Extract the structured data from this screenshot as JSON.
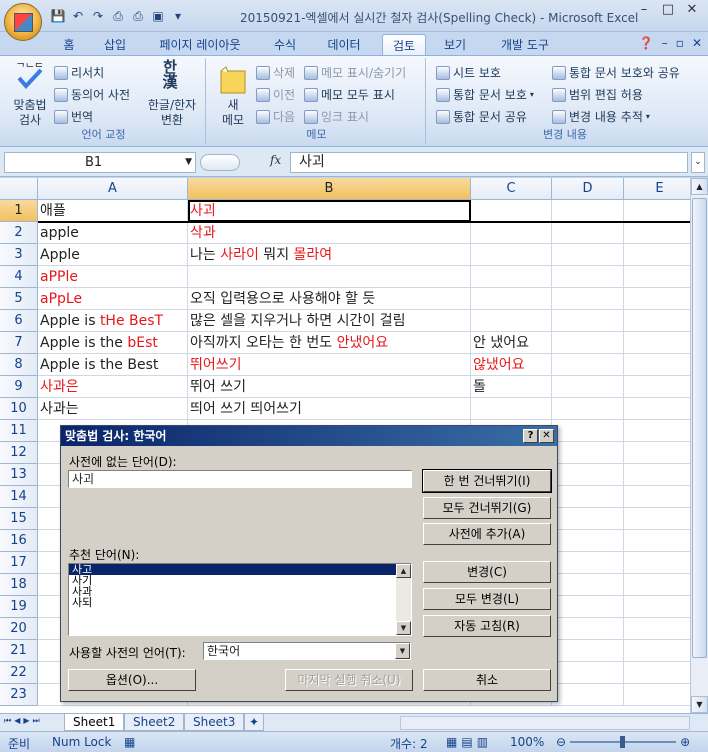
{
  "window": {
    "title": "20150921-엑셀에서 실시간 철자 검사(Spelling Check) - Microsoft Excel",
    "minimize": "–",
    "restore": "□",
    "close": "✕"
  },
  "qat": {
    "save": "▪",
    "undo": "↶",
    "redo": "↷",
    "print_preview": "⎙",
    "quick_print": "⎙",
    "spelling": "▣",
    "more": "▾"
  },
  "tabs": [
    "홈",
    "삽입",
    "페이지 레이아웃",
    "수식",
    "데이터",
    "검토",
    "보기",
    "개발 도구"
  ],
  "active_tab": "검토",
  "ribbon": {
    "proofing": {
      "label": "언어 교정",
      "spelling": "맞춤법\n검사",
      "research": "리서치",
      "thesaurus": "동의어 사전",
      "translate": "번역",
      "hanja": "한글/한자\n변환",
      "hanja_icon": "한\n漢"
    },
    "comments": {
      "label": "메모",
      "new": "새\n메모",
      "delete": "삭제",
      "previous": "이전",
      "next": "다음",
      "show_hide": "메모 표시/숨기기",
      "show_all": "메모 모두 표시",
      "show_ink": "잉크 표시"
    },
    "changes": {
      "label": "변경 내용",
      "protect_sheet": "시트 보호",
      "protect_workbook": "통합 문서 보호",
      "share_workbook": "통합 문서 공유",
      "protect_share": "통합 문서 보호와 공유",
      "allow_edit_ranges": "범위 편집 허용",
      "track_changes": "변경 내용 추적"
    }
  },
  "formula_bar": {
    "name_box": "B1",
    "fx": "fx",
    "value": "사괴"
  },
  "columns": [
    "A",
    "B",
    "C",
    "D",
    "E"
  ],
  "rows": [
    "1",
    "2",
    "3",
    "4",
    "5",
    "6",
    "7",
    "8",
    "9",
    "10",
    "11",
    "12",
    "13",
    "14",
    "15",
    "16",
    "17",
    "18",
    "19",
    "20",
    "21",
    "22",
    "23"
  ],
  "cells": {
    "A1": "애플",
    "B1": "사괴",
    "A2": "apple",
    "B2": "삭과",
    "A3": "Apple",
    "B3_1": "나는 ",
    "B3_2": "사라이",
    "B3_3": " 뭐지 ",
    "B3_4": "몰라여",
    "A4": "aPPle",
    "A5": "aPpLe",
    "B5": "오직 입력용으로 사용해야 할 듯",
    "A6_1": "Apple is ",
    "A6_2": "tHe",
    "A6_3": " ",
    "A6_4": "BesT",
    "B6": "많은 셀을 지우거나 하면 시간이 걸림",
    "A7_1": "Apple is the ",
    "A7_2": "bEst",
    "B7_1": "아직까지 오타는 한 번도 ",
    "B7_2": "안냈어요",
    "C7": "안 냈어요",
    "A8": "Apple is the Best",
    "B8": "뛰어쓰기",
    "C8": "않냈어요",
    "A9": "사과은",
    "B9": "뛰어 쓰기",
    "C9": "돌",
    "A10": "사과는",
    "B10": "띄어 쓰기 띄어쓰기"
  },
  "dialog": {
    "title": "맞춤법 검사: 한국어",
    "help": "?",
    "close": "✕",
    "not_in_dict_label": "사전에 없는 단어(D):",
    "not_in_dict_value": "사괴",
    "suggestions_label": "추천 단어(N):",
    "suggestions": [
      "사고",
      "사기",
      "사과",
      "사되"
    ],
    "selected_suggestion": "사고",
    "dictionary_language_label": "사용할 사전의 언어(T):",
    "dictionary_language": "한국어",
    "buttons": {
      "ignore_once": "한 번 건너뛰기(I)",
      "ignore_all": "모두 건너뛰기(G)",
      "add_to_dictionary": "사전에 추가(A)",
      "change": "변경(C)",
      "change_all": "모두 변경(L)",
      "autocorrect": "자동 고침(R)",
      "options": "옵션(O)...",
      "undo_last": "마지막 실행 취소(U)",
      "cancel": "취소"
    }
  },
  "sheets": [
    "Sheet1",
    "Sheet2",
    "Sheet3"
  ],
  "active_sheet": "Sheet1",
  "status": {
    "ready": "준비",
    "num_lock": "Num Lock",
    "count": "개수: 2",
    "zoom": "100%"
  },
  "colors": {
    "red_text": "#e8171b",
    "selection_header": "#f1c15f",
    "title_bar": "#0a246a"
  }
}
